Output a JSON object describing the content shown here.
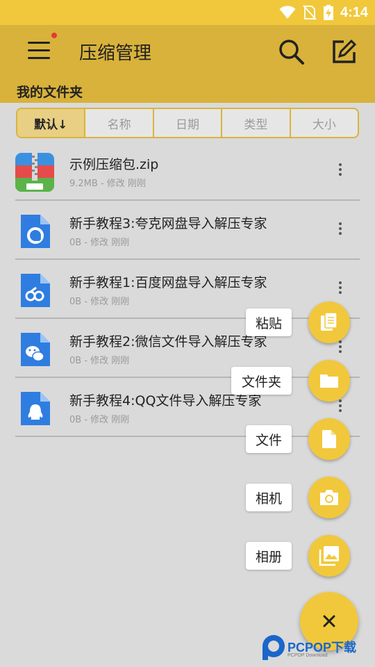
{
  "status_bar": {
    "time": "4:14",
    "icons": [
      "wifi-icon",
      "no-sim-icon",
      "battery-charging-icon"
    ]
  },
  "app_bar": {
    "title": "压缩管理",
    "icons": [
      "menu-icon",
      "search-icon",
      "edit-icon"
    ],
    "section_label": "我的文件夹"
  },
  "sort_bar": {
    "tabs": [
      "默认↓",
      "名称",
      "日期",
      "类型",
      "大小"
    ],
    "selected": "默认↓"
  },
  "files": [
    {
      "name": "示例压缩包.zip",
      "meta": "9.2MB - 修改 刚刚",
      "icon": "zip-archive-icon"
    },
    {
      "name": "新手教程3:夸克网盘导入解压专家",
      "meta": "0B - 修改 刚刚",
      "icon": "quark-file-icon"
    },
    {
      "name": "新手教程1:百度网盘导入解压专家",
      "meta": "0B - 修改 刚刚",
      "icon": "baidu-pan-file-icon"
    },
    {
      "name": "新手教程2:微信文件导入解压专家",
      "meta": "0B - 修改 刚刚",
      "icon": "wechat-file-icon"
    },
    {
      "name": "新手教程4:QQ文件导入解压专家",
      "meta": "0B - 修改 刚刚",
      "icon": "qq-file-icon"
    }
  ],
  "fab_menu": {
    "items": [
      {
        "label": "粘贴",
        "icon": "paste-icon"
      },
      {
        "label": "文件夹",
        "icon": "folder-icon"
      },
      {
        "label": "文件",
        "icon": "file-icon"
      },
      {
        "label": "相机",
        "icon": "camera-icon"
      },
      {
        "label": "相册",
        "icon": "gallery-icon"
      }
    ],
    "close_icon": "close-icon"
  },
  "watermark": {
    "text": "PCPOP下载",
    "subtext": "PCPOP Download"
  },
  "colors": {
    "status_bar": "#f1c83b",
    "app_bar": "#d8b23a",
    "accent": "#f1c83b",
    "background": "#dadada",
    "sort_selected": "#e8cf84"
  }
}
